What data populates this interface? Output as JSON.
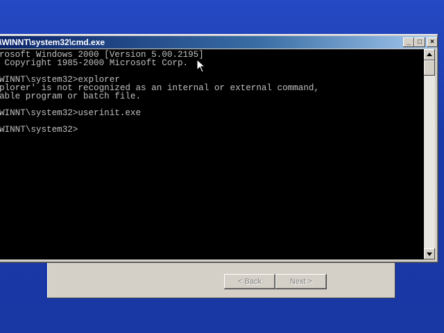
{
  "window": {
    "title": "\\WINNT\\system32\\cmd.exe",
    "min_label": "_",
    "max_label": "□",
    "close_label": "×"
  },
  "console": {
    "lines": [
      "rosoft Windows 2000 [Version 5.00.2195]",
      " Copyright 1985-2000 Microsoft Corp.",
      "",
      "WINNT\\system32>explorer",
      "plorer' is not recognized as an internal or external command,",
      "able program or batch file.",
      "",
      "WINNT\\system32>userinit.exe",
      "",
      "WINNT\\system32>"
    ]
  },
  "wizard": {
    "back_label": "< Back",
    "next_label": "Next >"
  },
  "colors": {
    "desktop": "#1f3fb4",
    "titlebar_start": "#0a246a",
    "titlebar_end": "#a6caf0",
    "console_text": "#c0c0c0"
  },
  "icons": {
    "cursor": "arrow-pointer-icon",
    "scroll_up": "triangle-up-icon",
    "scroll_down": "triangle-down-icon"
  }
}
